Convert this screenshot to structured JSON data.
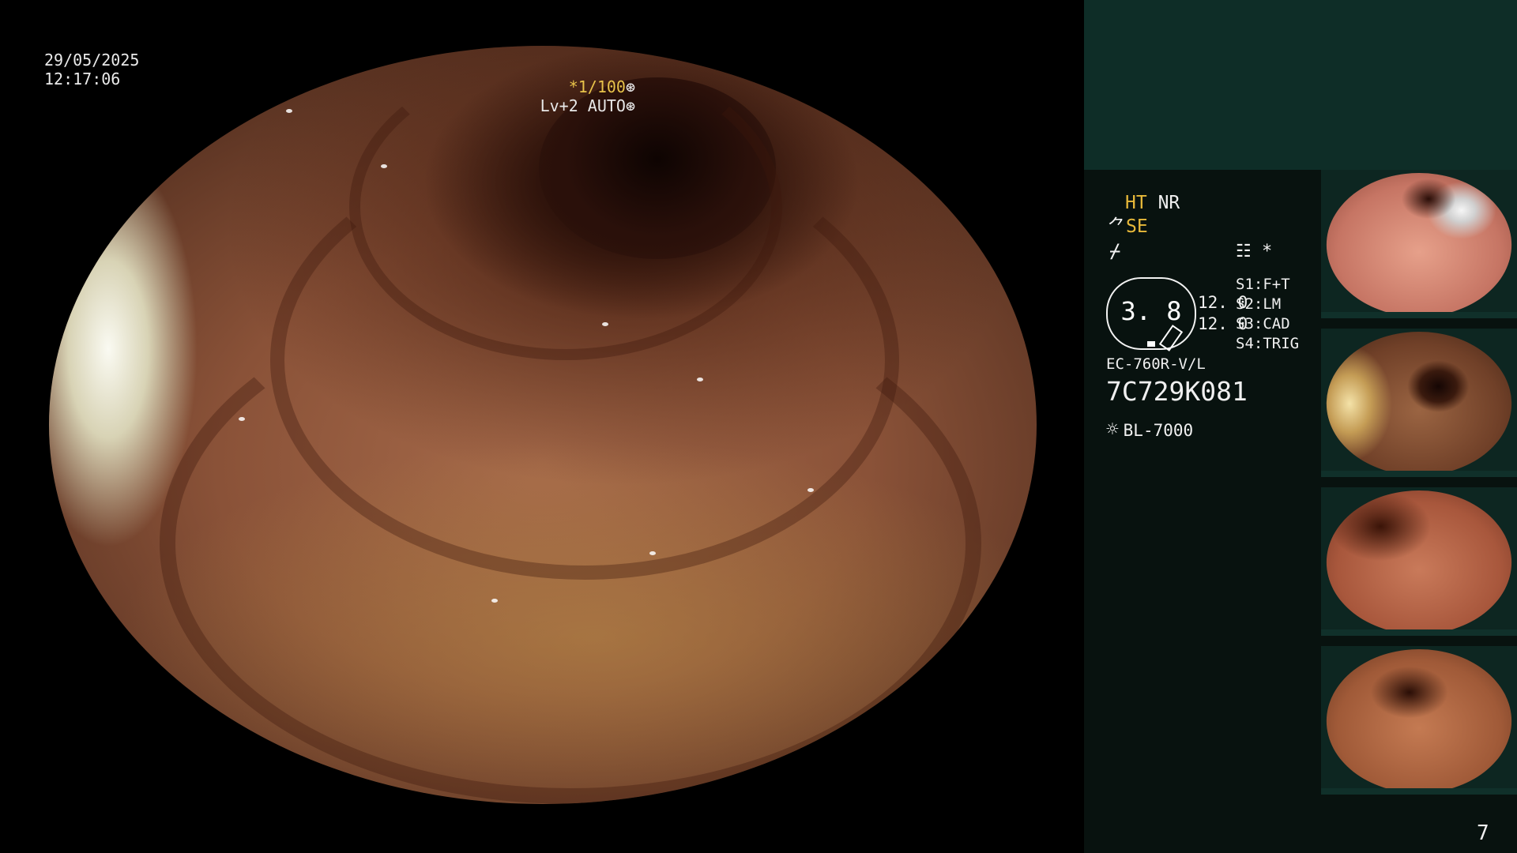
{
  "overlay": {
    "date": "29/05/2025",
    "time": "12:17:06",
    "shutter_value": "*1/100",
    "shutter_icon": "aperture-icon",
    "level_mode": "Lv+2 AUTO",
    "level_icon": "iris-icon"
  },
  "panel": {
    "ht": "HT",
    "nr": "NR",
    "se_prefix": "⺈",
    "se": "SE",
    "sym3": "⌿",
    "icon_left": "☷",
    "icon_right": "*",
    "gauge_value": "3. 8",
    "value_top": "12. 0",
    "value_bottom": "12. 0",
    "slots": [
      "S1:F+T",
      "S2:LM",
      "S3:CAD",
      "S4:TRIG"
    ],
    "model": "EC-760R-V/L",
    "serial": "7C729K081",
    "lamp_icon": "☼",
    "lamp": "BL-7000",
    "page": "7"
  },
  "thumbnails": [
    {
      "name": "thumbnail-1"
    },
    {
      "name": "thumbnail-2"
    },
    {
      "name": "thumbnail-3"
    },
    {
      "name": "thumbnail-4"
    }
  ],
  "colors": {
    "panel_bg": "#08120f",
    "panel_top": "#0e2d27",
    "highlight": "#e8b93a"
  }
}
